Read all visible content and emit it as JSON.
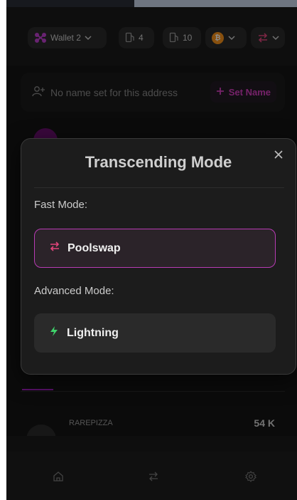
{
  "header": {
    "wallet_label": "Wallet 2",
    "sat_count_a": "4",
    "sat_count_b": "10",
    "coin_symbol": "₿"
  },
  "name_card": {
    "text": "No name set for this address",
    "button_label": "Set Name"
  },
  "token_list": {
    "items": [
      {
        "name": "RAREPIZZA",
        "amount": "54 K"
      }
    ]
  },
  "modal": {
    "title": "Transcending Mode",
    "fast_mode_label": "Fast Mode:",
    "fast_option_label": "Poolswap",
    "advanced_mode_label": "Advanced Mode:",
    "advanced_option_label": "Lightning"
  },
  "colors": {
    "accent_magenta": "#d63fc0",
    "selected_border": "#b83bb4",
    "lightning_green": "#3fd26b",
    "bitcoin_orange": "#f7931a"
  }
}
